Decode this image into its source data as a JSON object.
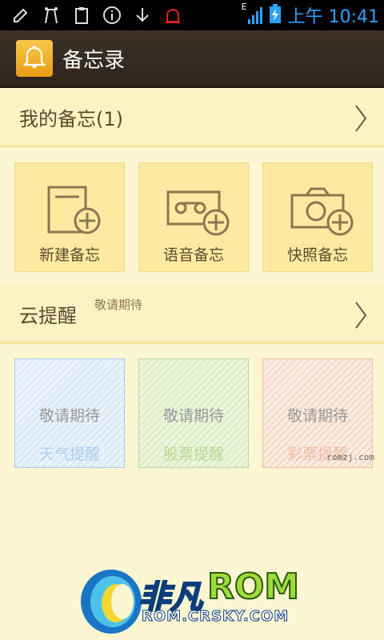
{
  "status_bar": {
    "time": "上午 10:41",
    "network_type": "E",
    "icons": [
      "edit-icon",
      "signal-tower-icon",
      "clipboard-icon",
      "info-icon",
      "download-icon",
      "alarm-icon",
      "signal-bars-icon",
      "battery-charging-icon"
    ]
  },
  "app": {
    "title": "备忘录",
    "logo_icon": "bell-icon"
  },
  "my_memos": {
    "label": "我的备忘(1)"
  },
  "memo_tiles": [
    {
      "label": "新建备忘",
      "icon": "new-note-plus-icon"
    },
    {
      "label": "语音备忘",
      "icon": "voice-tape-plus-icon"
    },
    {
      "label": "快照备忘",
      "icon": "camera-plus-icon"
    }
  ],
  "cloud_reminder": {
    "label": "云提醒",
    "sublabel": "敬请期待"
  },
  "reminder_tiles": [
    {
      "main": "敬请期待",
      "faint": "天气提醒",
      "color": "#4a90d9"
    },
    {
      "main": "敬请期待",
      "faint": "股票提醒",
      "color": "#6aaa2a"
    },
    {
      "main": "敬请期待",
      "faint": "彩票提醒",
      "color": "#d9784a"
    }
  ],
  "watermark": "romzj.com",
  "footer": {
    "brand_cn": "非凡",
    "brand_rom": "ROM",
    "url": "ROM.CRSKY.COM"
  },
  "colors": {
    "background": "#fdf6d2",
    "title_bar": "#3e3228",
    "tile": "#fde9a0",
    "text_brown": "#5d4a2e",
    "clock_blue": "#2ea0ff"
  }
}
